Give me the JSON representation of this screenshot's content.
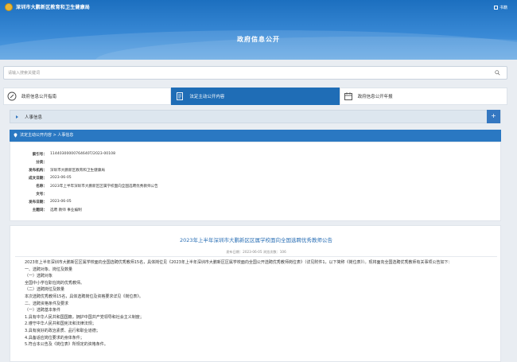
{
  "header": {
    "site_name": "深圳市大鹏新区教育和卫生健康局",
    "tools_label": "书籍",
    "page_title": "政府信息公开"
  },
  "search": {
    "placeholder": "请输入搜索关键词"
  },
  "tabs": [
    {
      "label": "政府信息公开指南",
      "icon": "compass-icon",
      "active": false
    },
    {
      "label": "法定主动公开内容",
      "icon": "document-icon",
      "active": true
    },
    {
      "label": "政府信息公开年报",
      "icon": "calendar-icon",
      "active": false
    }
  ],
  "section": {
    "label": "人事信息",
    "plus": "+"
  },
  "breadcrumb": {
    "text": "法定主动公开内容 > 人事信息"
  },
  "meta": [
    {
      "key": "索引号：",
      "value": "11440300000764640T/2023-00108"
    },
    {
      "key": "分类：",
      "value": ""
    },
    {
      "key": "发布机构：",
      "value": "深圳市大鹏新区教育和卫生健康局"
    },
    {
      "key": "成文日期：",
      "value": "2023-06-05"
    },
    {
      "key": "名称：",
      "value": "2023年上半年深圳市大鹏新区区属学校面向全国选聘优秀教师公告"
    },
    {
      "key": "文号：",
      "value": ""
    },
    {
      "key": "发布日期：",
      "value": "2023-06-05"
    },
    {
      "key": "主题词：",
      "value": "选聘 教师 事业编制"
    }
  ],
  "article": {
    "title": "2023年上半年深圳市大鹏新区区属学校面向全国选聘优秀教师公告",
    "meta_line": "发布日期：2023-06-05   浏览次数：106",
    "paragraphs": [
      "2023年上半年深圳市大鹏新区区属学校面向全国选聘优秀教师15名，具体岗位见《2023年上半年深圳市大鹏新区区属学校面向全国公开选聘优秀教师岗位表》（详见附件1，以下简称《岗位表》）。现将面向全国选聘优秀教师有关事项公告如下：",
      "一、选聘对象、岗位及数量",
      "（一）选聘对象",
      "全国中小学在职在岗的优秀教师。",
      "（二）选聘岗位及数量",
      "本次选聘优秀教师15名，具体选聘岗位及资格要求详见《岗位表》。",
      "二、选聘资格条件及要求",
      "（一）选聘基本条件",
      "1.具有中华人民共和国国籍，拥护中国共产党领导和社会主义制度；",
      "2.遵守中华人民共和国宪法和法律法规；",
      "3.具有良好的政治素质、品行和职业道德；",
      "4.具备适应岗位要求的身体条件；",
      "5.符合本公告及《岗位表》所规定的资格条件。"
    ]
  },
  "colors": {
    "header_blue": "#1c6fbf",
    "active_tab": "#1f6db6",
    "breadcrumb_bar": "#2a78c2",
    "title_blue": "#2a6fb5"
  }
}
